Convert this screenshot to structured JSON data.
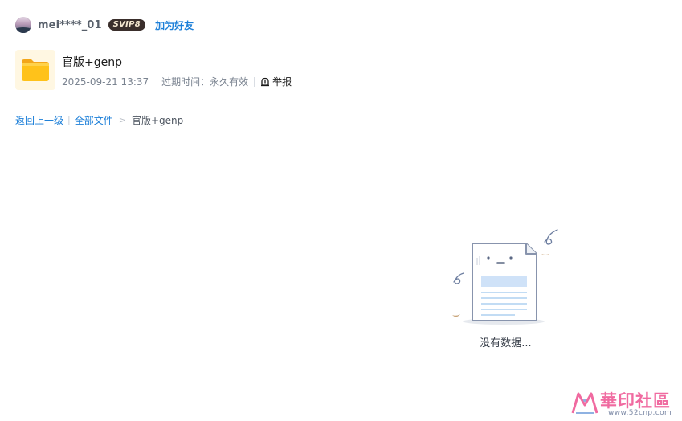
{
  "user": {
    "name": "mei****_01",
    "vip_label": "SVIP8",
    "add_friend_label": "加为好友"
  },
  "file": {
    "title": "官版+genp",
    "date": "2025-09-21 13:37",
    "expiry": "过期时间：永久有效",
    "report_label": "举报"
  },
  "breadcrumb": {
    "back_label": "返回上一级",
    "all_files_label": "全部文件",
    "separator": ">",
    "current_label": "官版+genp"
  },
  "empty_state": {
    "text": "没有数据..."
  },
  "watermark": {
    "cn_text": "華印社區",
    "url_text": "www.52cnp.com"
  },
  "colors": {
    "link_blue": "#1c7fd8",
    "folder_yellow": "#ffc21a",
    "watermark_pink": "#f06aa0"
  },
  "icons": {
    "avatar": "user-avatar",
    "folder": "folder-icon",
    "report": "report-flag-icon",
    "empty_illustration": "empty-document-illustration"
  }
}
